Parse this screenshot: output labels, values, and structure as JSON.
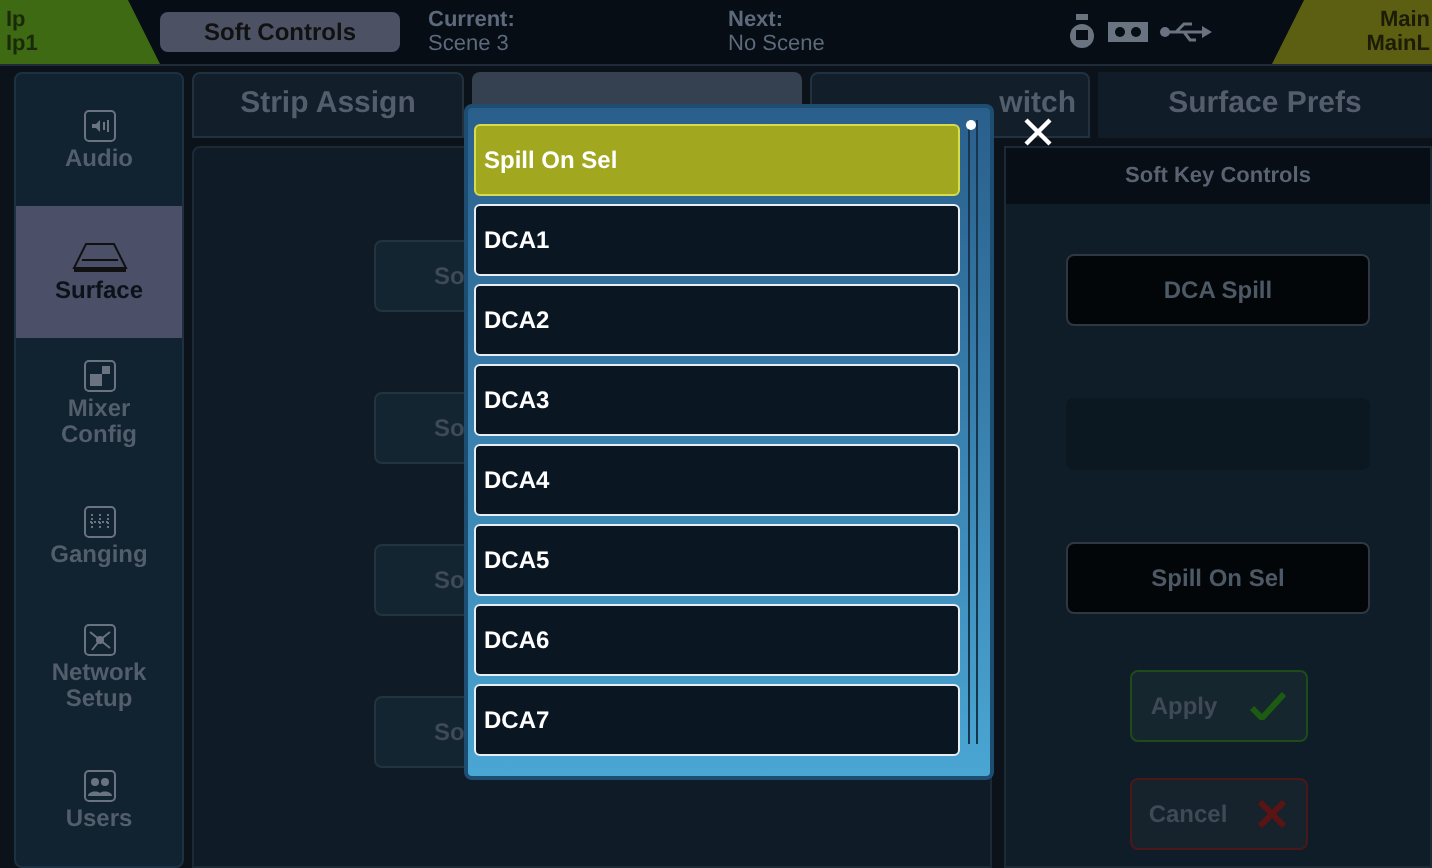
{
  "status_bar": {
    "left": {
      "line1": "Ip",
      "line2": "Ip1"
    },
    "active_tab": "Soft Controls",
    "current": {
      "label": "Current:",
      "value": "Scene 3"
    },
    "next": {
      "label": "Next:",
      "value": "No Scene"
    },
    "right": {
      "line1": "Main",
      "line2": "MainL"
    }
  },
  "sidebar": {
    "items": [
      {
        "kind": "audio",
        "label": "Audio",
        "selected": false
      },
      {
        "kind": "surface",
        "label": "Surface",
        "selected": true
      },
      {
        "kind": "mixer",
        "label": "Mixer Config",
        "selected": false
      },
      {
        "kind": "ganging",
        "label": "Ganging",
        "selected": false
      },
      {
        "kind": "network",
        "label": "Network Setup",
        "selected": false
      },
      {
        "kind": "users",
        "label": "Users",
        "selected": false
      }
    ]
  },
  "tabs": [
    {
      "label": "Strip Assign"
    },
    {
      "label": "witch"
    },
    {
      "label": "Surface Prefs"
    }
  ],
  "left_panel": {
    "buttons": [
      "So",
      "So",
      "So",
      "So"
    ]
  },
  "right_panel": {
    "title": "Soft Key Controls",
    "keys": [
      {
        "kind": "assigned",
        "label": "DCA Spill"
      },
      {
        "kind": "empty"
      },
      {
        "kind": "assigned",
        "label": "Spill On Sel"
      }
    ],
    "apply": "Apply",
    "cancel": "Cancel"
  },
  "popup": {
    "items": [
      {
        "label": "Spill On Sel",
        "selected": true
      },
      {
        "label": "DCA1",
        "selected": false
      },
      {
        "label": "DCA2",
        "selected": false
      },
      {
        "label": "DCA3",
        "selected": false
      },
      {
        "label": "DCA4",
        "selected": false
      },
      {
        "label": "DCA5",
        "selected": false
      },
      {
        "label": "DCA6",
        "selected": false
      },
      {
        "label": "DCA7",
        "selected": false
      }
    ]
  }
}
